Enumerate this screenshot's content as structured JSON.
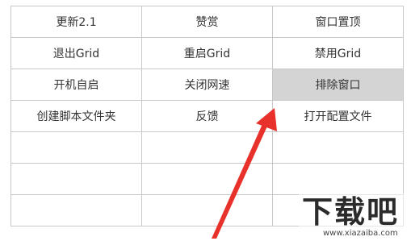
{
  "menu": {
    "rows": [
      [
        "更新2.1",
        "赞赏",
        "窗口置顶"
      ],
      [
        "退出Grid",
        "重启Grid",
        "禁用Grid"
      ],
      [
        "开机自启",
        "关闭网速",
        "排除窗口"
      ],
      [
        "创建脚本文件夹",
        "反馈",
        "打开配置文件"
      ],
      [
        "",
        "",
        ""
      ],
      [
        "",
        "",
        ""
      ],
      [
        "",
        "",
        ""
      ]
    ],
    "highlighted_item": "排除窗口",
    "highlight_color": "#d4d4d4",
    "border_color": "#c8c8c8"
  },
  "annotation": {
    "arrow_color": "#e8312a"
  },
  "watermark": {
    "text": "下载吧",
    "url": "www.xiazaiba.com"
  }
}
